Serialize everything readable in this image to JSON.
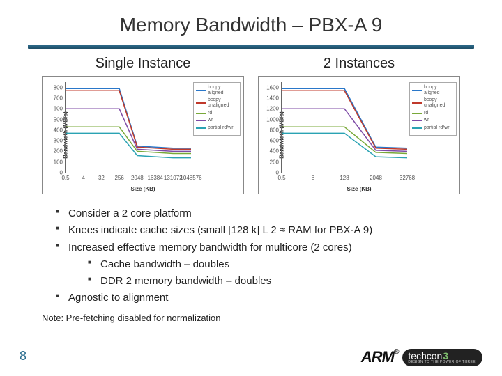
{
  "title": "Memory Bandwidth – PBX-A 9",
  "columns": {
    "left_title": "Single Instance",
    "right_title": "2 Instances"
  },
  "bullets": {
    "b1": "Consider a 2 core platform",
    "b2": "Knees indicate cache sizes (small [128 k] L 2 ≈ RAM for PBX-A 9)",
    "b3": "Increased effective memory bandwidth for multicore (2 cores)",
    "b3a": "Cache bandwidth – doubles",
    "b3b": "DDR 2 memory bandwidth – doubles",
    "b4": "Agnostic to alignment"
  },
  "note": "Note: Pre-fetching disabled for normalization",
  "page_number": "8",
  "footer": {
    "arm": "ARM",
    "reg": "®",
    "techcon": "techcon",
    "three": "3",
    "tagline": "DESIGN TO THE POWER OF THREE"
  },
  "chart_data": [
    {
      "type": "line",
      "title": "Single Instance",
      "xlabel": "Size (KB)",
      "ylabel": "Bandwidth (MB/s)",
      "x": [
        0.5,
        4,
        32,
        256,
        2048,
        16384,
        131072,
        1048576
      ],
      "ylim": [
        0,
        850
      ],
      "yticks": [
        0,
        100,
        200,
        300,
        400,
        500,
        600,
        700,
        800
      ],
      "series": [
        {
          "name": "bcopy aligned",
          "color": "#2a77c9",
          "values": [
            790,
            790,
            790,
            790,
            250,
            240,
            230,
            230
          ]
        },
        {
          "name": "bcopy unaligned",
          "color": "#c0392b",
          "values": [
            770,
            770,
            770,
            770,
            240,
            230,
            220,
            220
          ]
        },
        {
          "name": "rd",
          "color": "#79a939",
          "values": [
            430,
            430,
            430,
            430,
            200,
            190,
            180,
            180
          ]
        },
        {
          "name": "wr",
          "color": "#7d4aa6",
          "values": [
            600,
            600,
            600,
            600,
            220,
            210,
            200,
            200
          ]
        },
        {
          "name": "partial rd/wr",
          "color": "#2aa3b3",
          "values": [
            370,
            370,
            370,
            370,
            160,
            150,
            140,
            140
          ]
        }
      ]
    },
    {
      "type": "line",
      "title": "2 Instances",
      "xlabel": "Size (KB)",
      "ylabel": "Bandwidth (MB/s)",
      "x": [
        0.5,
        8,
        128,
        2048,
        32768
      ],
      "ylim": [
        0,
        1700
      ],
      "yticks": [
        0,
        200,
        400,
        600,
        800,
        1000,
        1200,
        1400,
        1600
      ],
      "series": [
        {
          "name": "bcopy aligned",
          "color": "#2a77c9",
          "values": [
            1580,
            1580,
            1580,
            480,
            460
          ]
        },
        {
          "name": "bcopy unaligned",
          "color": "#c0392b",
          "values": [
            1540,
            1540,
            1540,
            460,
            440
          ]
        },
        {
          "name": "rd",
          "color": "#79a939",
          "values": [
            860,
            860,
            860,
            380,
            360
          ]
        },
        {
          "name": "wr",
          "color": "#7d4aa6",
          "values": [
            1200,
            1200,
            1200,
            420,
            400
          ]
        },
        {
          "name": "partial rd/wr",
          "color": "#2aa3b3",
          "values": [
            740,
            740,
            740,
            300,
            280
          ]
        }
      ]
    }
  ]
}
